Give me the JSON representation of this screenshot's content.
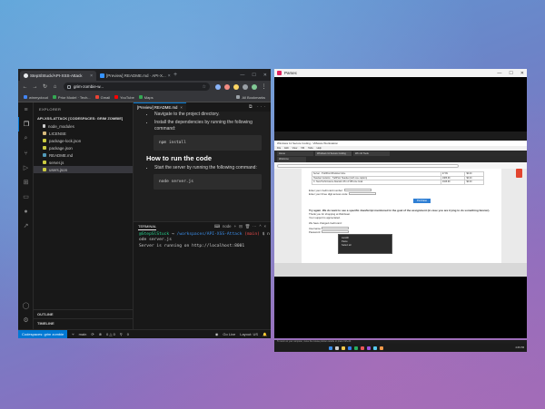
{
  "chrome": {
    "tabs": [
      {
        "label": "StepSlStuck/API-XSS-Attack",
        "active": true
      },
      {
        "label": "[Preview] README.md · API-X...",
        "active": false
      }
    ],
    "address": "grim-zombie-w...",
    "bookmarks": [
      {
        "label": "winmycloud",
        "color": "#4285f4"
      },
      {
        "label": "Prior Model · Tech...",
        "color": "#34a853"
      },
      {
        "label": "Gmail",
        "color": "#ea4335"
      },
      {
        "label": "YouTube",
        "color": "#ff0000"
      },
      {
        "label": "Maps",
        "color": "#34a853"
      }
    ],
    "all_bookmarks": "All Bookmarks"
  },
  "vscode": {
    "explorer_title": "EXPLORER",
    "root": "API-XSS-ATTACK [CODESPACES: GRIM ZOMBIE]",
    "files": [
      {
        "name": "node_modules",
        "color": "#cccccc"
      },
      {
        "name": "LICENSE",
        "color": "#d7ba7d"
      },
      {
        "name": "package-lock.json",
        "color": "#cbcb41"
      },
      {
        "name": "package.json",
        "color": "#cbcb41"
      },
      {
        "name": "README.md",
        "color": "#519aba"
      },
      {
        "name": "server.js",
        "color": "#cbcb41"
      },
      {
        "name": "users.json",
        "color": "#cbcb41"
      }
    ],
    "outline": "OUTLINE",
    "timeline": "TIMELINE",
    "editor_tab": "[Preview] README.md",
    "preview": {
      "li1": "Navigate to the project directory.",
      "li2": "Install the dependencies by running the following command:",
      "code1": "npm install",
      "heading": "How to run the code",
      "li3": "Start the server by running the following command:",
      "code2": "node server.js"
    },
    "terminal": {
      "tab": "TERMINAL",
      "shell": "node",
      "user": "@StepSlStuck",
      "arrow": "→",
      "path": "/workspaces/API-XSS-Attack",
      "branch": "(main)",
      "prompt_end": "$ n",
      "cont": "ode server.js",
      "output": "Server is running on http://localhost:8001"
    },
    "status": {
      "remote": "Codespaces: grim zombie",
      "branch": "main",
      "errors": "0 △ 0",
      "ports": "0",
      "golive": "Go Live",
      "layout": "Layout: US"
    }
  },
  "parsec": {
    "title": "Parsec",
    "vm_title": "Windows 11 Secure Coding - VMware Workstation",
    "vm_menu": [
      "File",
      "Edit",
      "View",
      "VM",
      "Tabs",
      "Help"
    ],
    "vm_tabs": [
      "Home",
      "Windows 11 Secure Coding",
      "Win 10 Tools"
    ],
    "inner_tab": "Welcome",
    "table_rows": [
      [
        "Server - TrafiPost Windows Cube",
        "27.99",
        "$0.00"
      ],
      [
        "Headset Guitarist - TrafiPost Headset (with one caption)",
        "1986.99",
        "$0.00"
      ],
      [
        "C. New Performance Abandon Pro of DB Line Goal",
        "1946.99",
        "$0.00"
      ]
    ],
    "labels": {
      "credit": "Enter your credit card number:",
      "code": "Enter your three digit access code:",
      "button": "Purchase",
      "note": "Try again. We do want to see a specific JavaScript mentioned in the goal of the assignment (in case you are trying to do something fancier).",
      "n1": "Thank you for shopping at WebGoat.",
      "n2": "Your support is appreciated.",
      "n3": "We have charged credit card:",
      "username": "Username:",
      "password": "Password:"
    },
    "context_menu": [
      "Autofill",
      "Paste",
      "Select all"
    ],
    "footer": "To return to your computer, move the mouse pointer outside or press Ctrl+Alt.",
    "clock": "4:26 PM"
  }
}
